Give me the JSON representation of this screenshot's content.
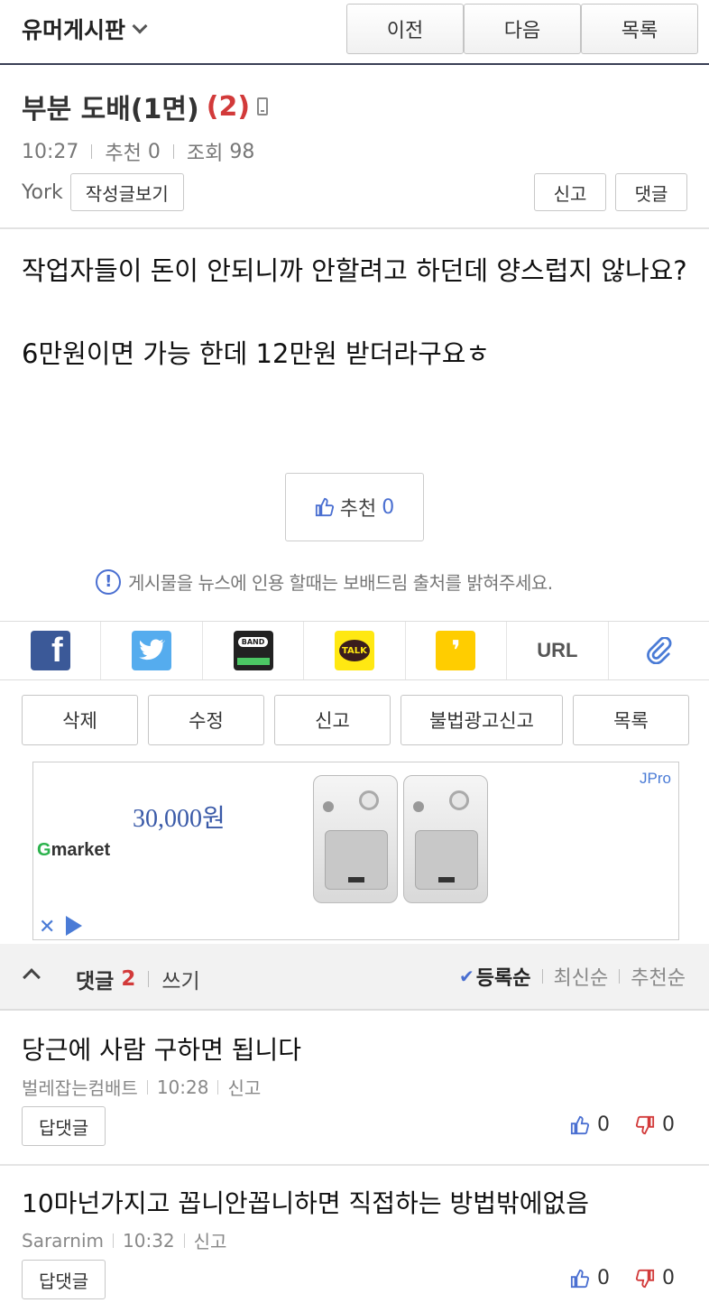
{
  "topbar": {
    "board_title": "유머게시판",
    "prev_label": "이전",
    "next_label": "다음",
    "list_label": "목록"
  },
  "post": {
    "title": "부분 도배(1면)",
    "comment_count_badge": "(2)",
    "time": "10:27",
    "recommend_label": "추천",
    "recommend_count": "0",
    "views_label": "조회",
    "views_count": "98",
    "author": "York",
    "view_posts_label": "작성글보기",
    "report_label": "신고",
    "comment_label": "댓글",
    "body_line1": "작업자들이 돈이 안되니까 안할려고 하던데 양스럽지 않나요?",
    "body_line2": "6만원이면 가능 한데 12만원 받더라구요ㅎ",
    "recommend_button_label": "추천",
    "recommend_button_count": "0",
    "notice": "게시물을 뉴스에 인용 할때는 보배드림 출처를 밝혀주세요."
  },
  "share": {
    "url_label": "URL",
    "icons": [
      "facebook-icon",
      "twitter-icon",
      "band-icon",
      "kakaotalk-icon",
      "kakaostory-icon",
      "url-icon",
      "attachment-icon"
    ],
    "band_text": "BAND",
    "talk_text": "TALK"
  },
  "actions": {
    "delete": "삭제",
    "edit": "수정",
    "report": "신고",
    "illegal_ad_report": "불법광고신고",
    "list": "목록"
  },
  "ad": {
    "price": "30,000원",
    "brand": "market",
    "brand_g": "G",
    "badge": "JPro"
  },
  "comments_header": {
    "title": "댓글",
    "count": "2",
    "write": "쓰기",
    "sort_registered": "등록순",
    "sort_latest": "최신순",
    "sort_recommended": "추천순"
  },
  "comments": [
    {
      "text": "당근에 사람 구하면 됩니다",
      "author": "벌레잡는컴배트",
      "time": "10:28",
      "report": "신고",
      "reply": "답댓글",
      "up": "0",
      "down": "0"
    },
    {
      "text": "10마넌가지고 꼽니안꼽니하면 직접하는 방법밖에없음",
      "author": "Sararnim",
      "time": "10:32",
      "report": "신고",
      "reply": "답댓글",
      "up": "0",
      "down": "0"
    }
  ],
  "colors": {
    "accent_blue": "#4a6fd1",
    "count_red": "#d23a3a",
    "header_border": "#3a3f55"
  }
}
